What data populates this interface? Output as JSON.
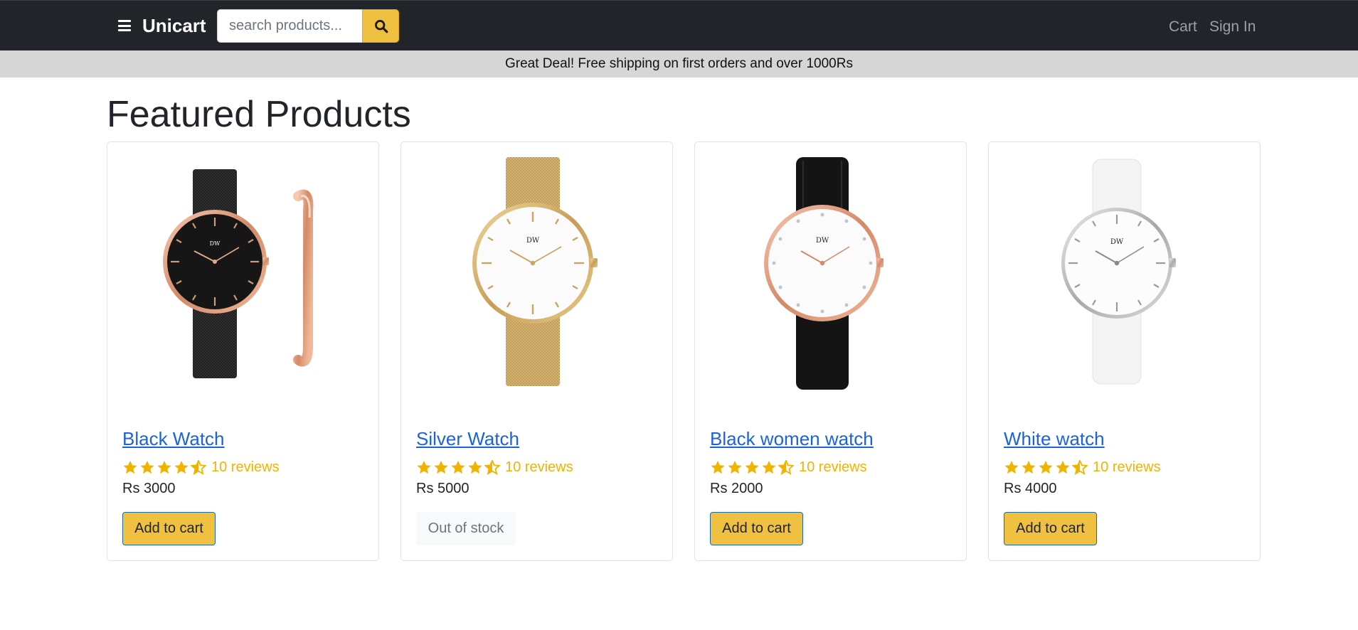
{
  "header": {
    "brand": "Unicart",
    "search": {
      "placeholder": "search products...",
      "value": ""
    },
    "nav": {
      "cart": "Cart",
      "sign_in": "Sign In"
    }
  },
  "promo": {
    "text": "Great Deal! Free shipping on first orders and over 1000Rs"
  },
  "main": {
    "title": "Featured Products",
    "products": [
      {
        "name": "Black Watch",
        "rating": 4.5,
        "reviews": "10 reviews",
        "price": "Rs 3000",
        "action": "Add to cart",
        "in_stock": true
      },
      {
        "name": "Silver Watch",
        "rating": 4.5,
        "reviews": "10 reviews",
        "price": "Rs 5000",
        "action": "Out of stock",
        "in_stock": false
      },
      {
        "name": "Black women watch",
        "rating": 4.5,
        "reviews": "10 reviews",
        "price": "Rs 2000",
        "action": "Add to cart",
        "in_stock": true
      },
      {
        "name": "White watch",
        "rating": 4.5,
        "reviews": "10 reviews",
        "price": "Rs 4000",
        "action": "Add to cart",
        "in_stock": true
      }
    ]
  },
  "colors": {
    "navbar": "#212529",
    "accent": "#f0c040",
    "link": "#1a63d9",
    "star": "#f0b400",
    "promo_bg": "#d6d6d6"
  },
  "icons": {
    "menu": "hamburger-icon",
    "search": "search-icon",
    "star": "star-icon",
    "half_star": "star-half-icon"
  }
}
